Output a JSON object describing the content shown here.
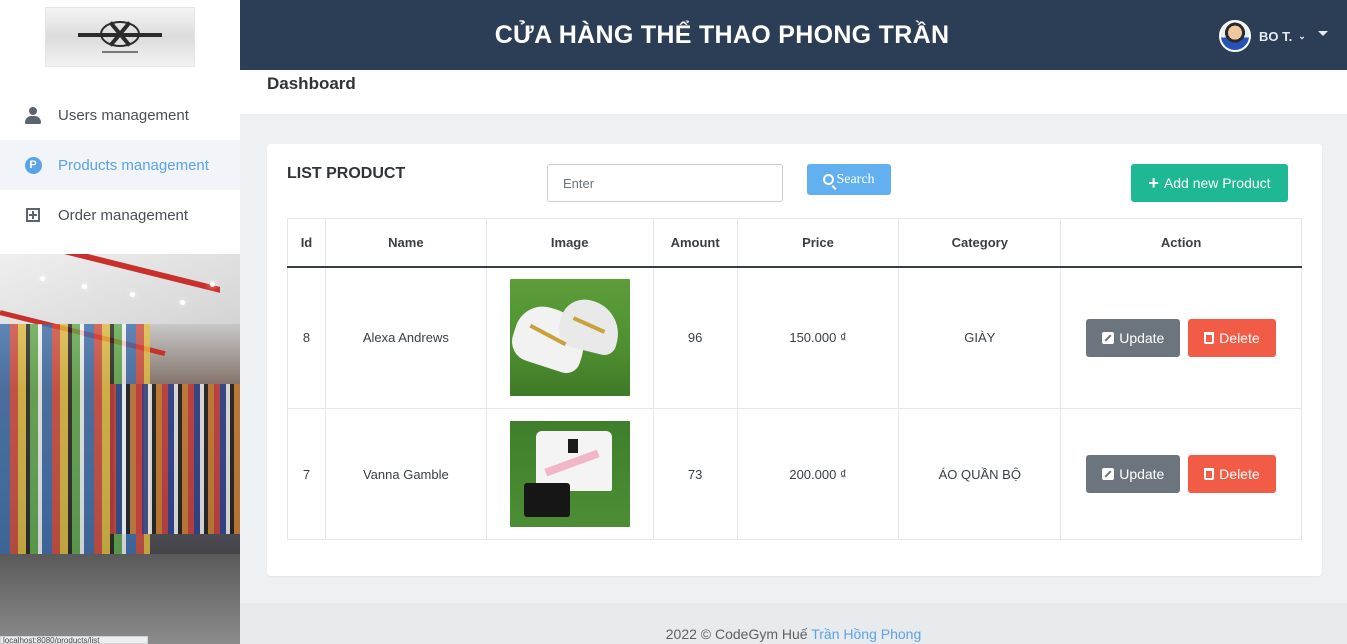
{
  "header": {
    "title": "CỬA HÀNG THỂ THAO PHONG TRẦN",
    "user_name": "BO T.",
    "user_chevron": "⌄"
  },
  "sidebar": {
    "items": [
      {
        "label": "Users management",
        "icon": "user-icon",
        "active": false
      },
      {
        "label": "Products management",
        "icon": "products-icon",
        "active": true
      },
      {
        "label": "Order management",
        "icon": "order-icon",
        "active": false
      }
    ],
    "status_url": "localhost:8080/products/list"
  },
  "page": {
    "heading": "Dashboard"
  },
  "product_list": {
    "title": "LIST PRODUCT",
    "search_placeholder": "Enter",
    "search_label": "Search",
    "add_label": "Add new Product",
    "columns": [
      "Id",
      "Name",
      "Image",
      "Amount",
      "Price",
      "Category",
      "Action"
    ],
    "rows": [
      {
        "id": "8",
        "name": "Alexa Andrews",
        "image": "white-football-boots",
        "amount": "96",
        "price": "150.000 ₫",
        "category": "GIÀY",
        "update_label": "Update",
        "delete_label": "Delete"
      },
      {
        "id": "7",
        "name": "Vanna Gamble",
        "image": "psg-white-kit",
        "amount": "73",
        "price": "200.000 ₫",
        "category": "ÁO QUẦN BỘ",
        "update_label": "Update",
        "delete_label": "Delete"
      }
    ]
  },
  "footer": {
    "text": "2022 © CodeGym Huế",
    "author": "Trần Hồng Phong"
  },
  "colors": {
    "header_bg": "#2c3e56",
    "active_nav": "#5aa3e6",
    "search_btn": "#62b0f0",
    "add_btn": "#1fb894",
    "update_btn": "#6c757d",
    "delete_btn": "#f25c47"
  }
}
